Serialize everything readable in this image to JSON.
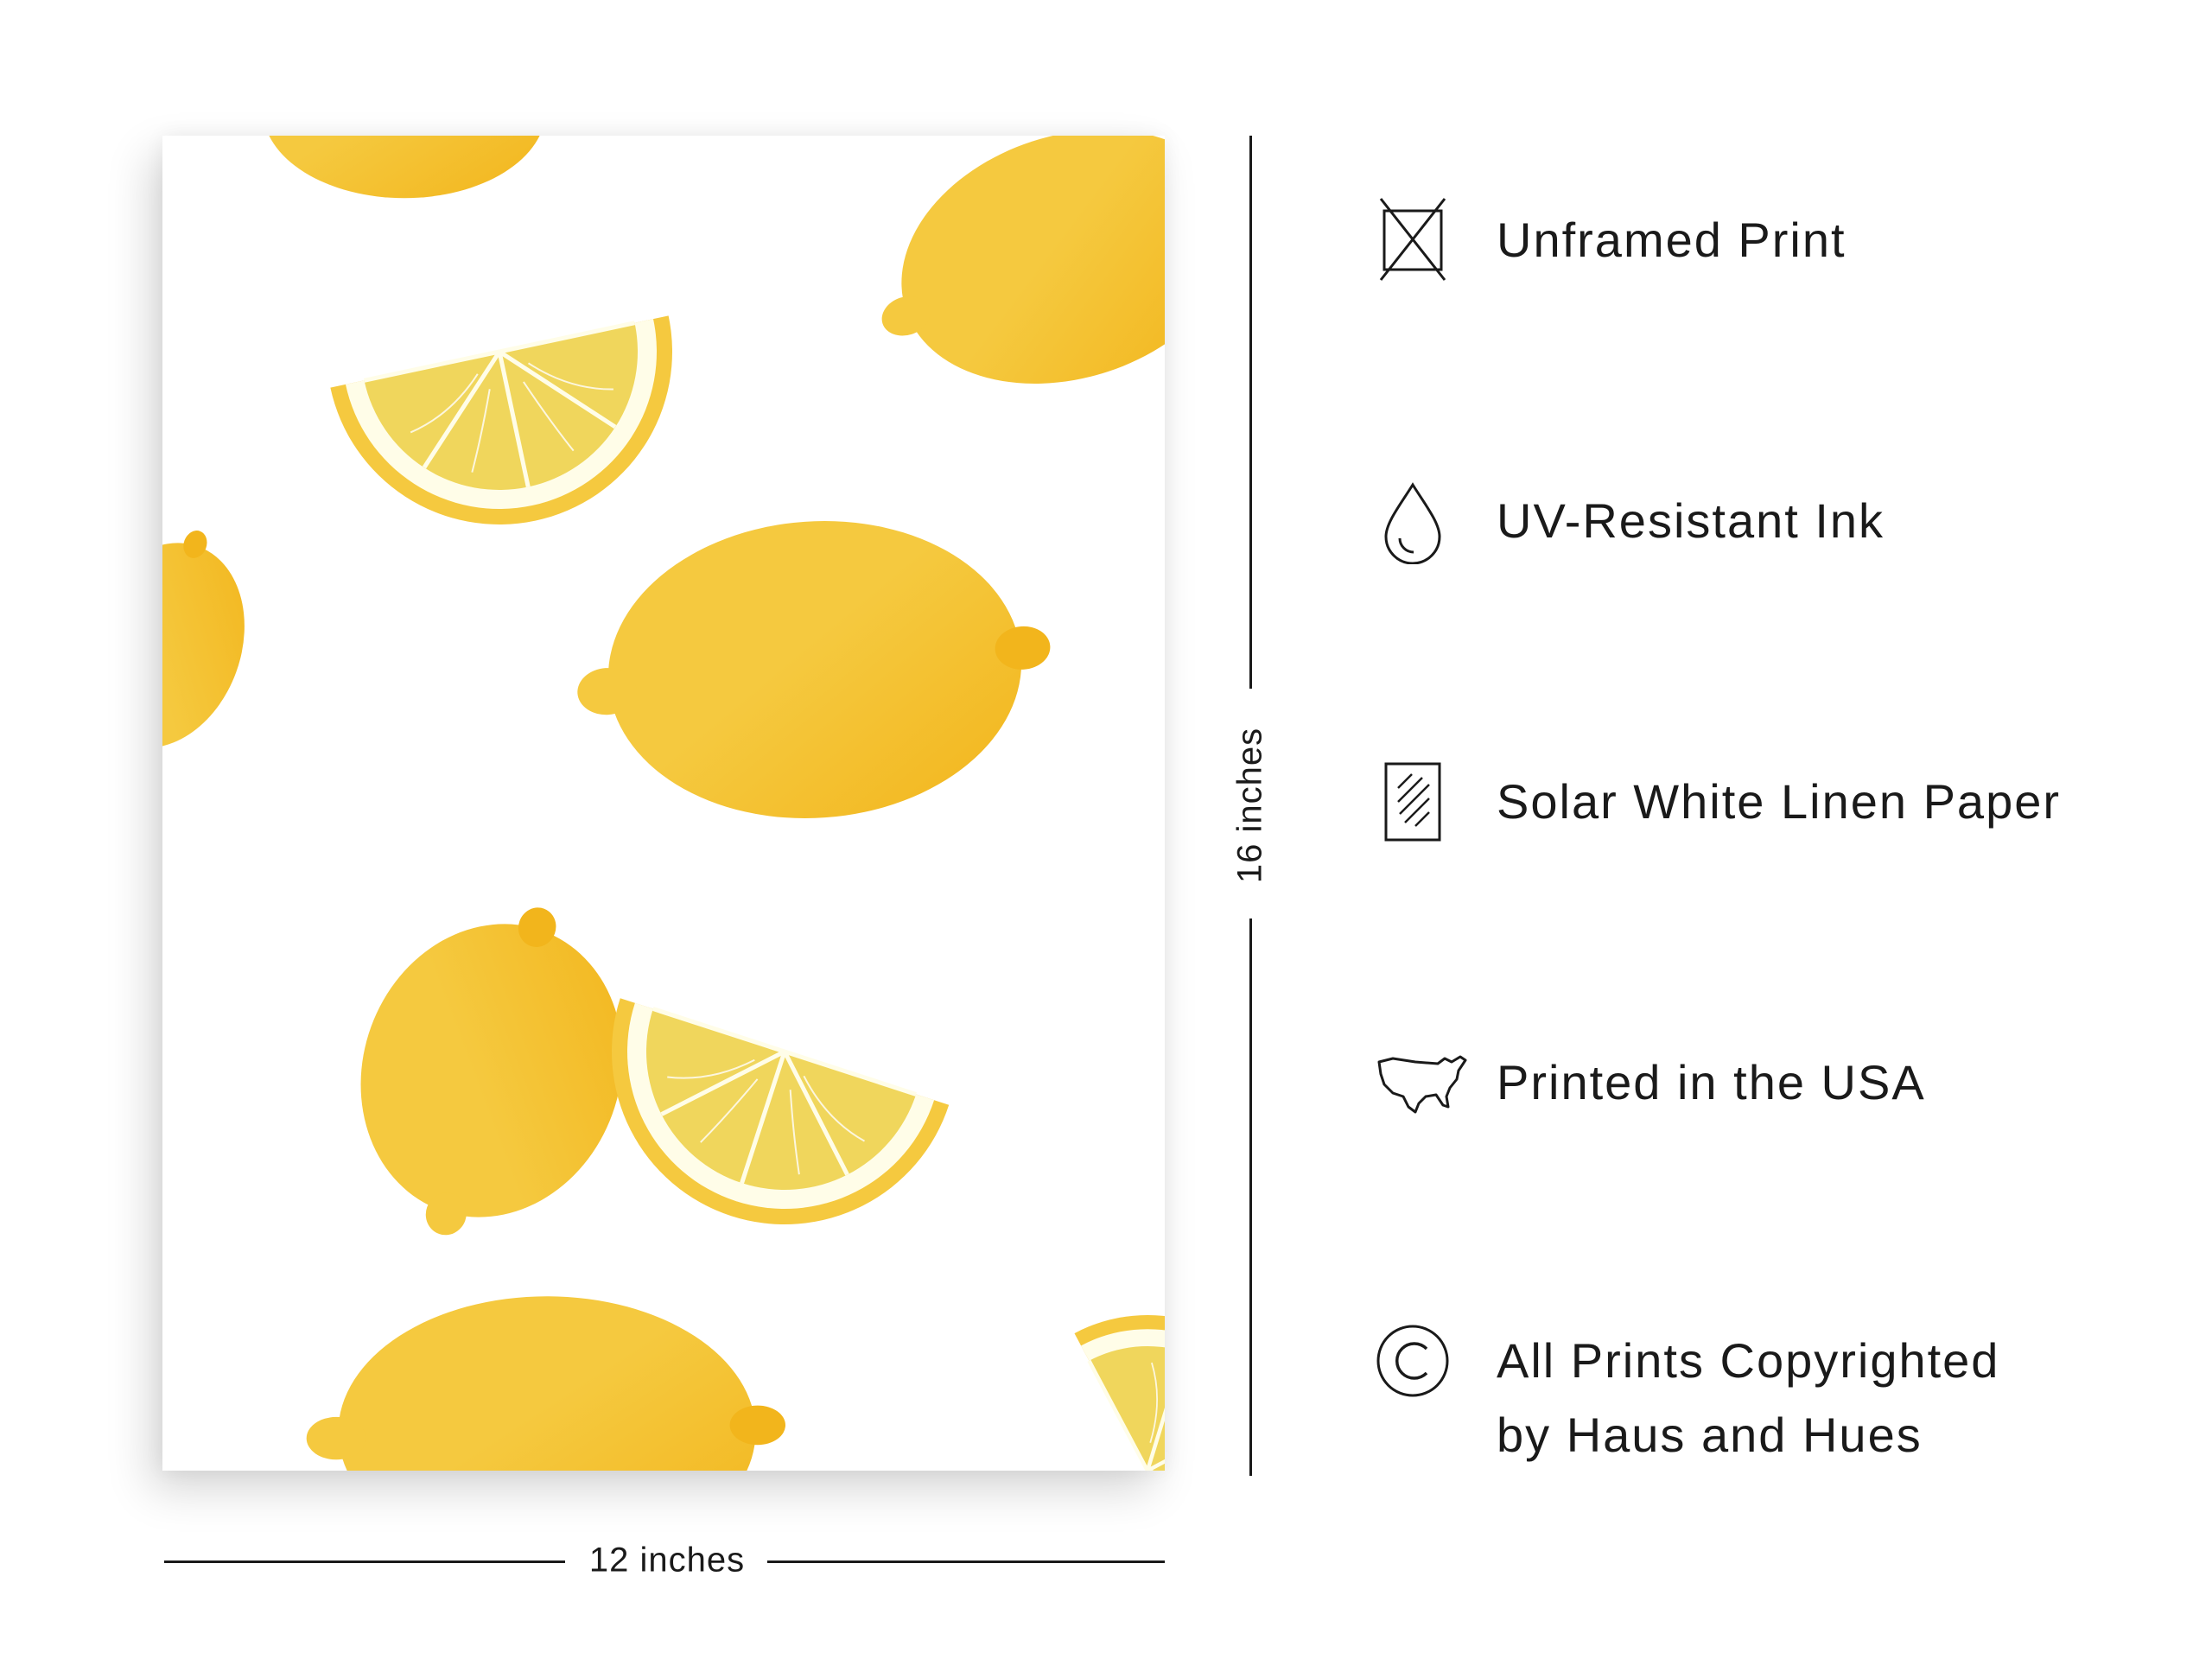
{
  "dimensions": {
    "height_label": "16 inches",
    "width_label": "12 inches"
  },
  "features": [
    {
      "icon": "unframed-print-icon",
      "label": "Unframed Print"
    },
    {
      "icon": "ink-drop-icon",
      "label": "UV-Resistant Ink"
    },
    {
      "icon": "linen-paper-icon",
      "label": "Solar White Linen Paper"
    },
    {
      "icon": "usa-map-icon",
      "label": "Printed in the USA"
    },
    {
      "icon": "copyright-icon",
      "label_line1": "All Prints Copyrighted",
      "label_line2": "by Haus and Hues"
    }
  ],
  "colors": {
    "lemon": "#f5c93f",
    "lemon_shadow": "#f2b51c",
    "lemon_flesh": "#f0d65c",
    "pith": "#fffde8",
    "text": "#1a1a1a"
  }
}
